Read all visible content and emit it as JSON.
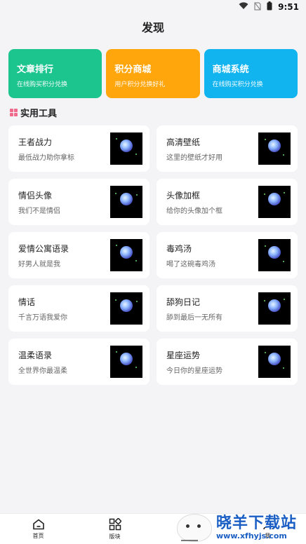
{
  "status_bar": {
    "time": "9:51"
  },
  "header": {
    "title": "发现"
  },
  "promos": [
    {
      "title": "文章排行",
      "subtitle": "在线购买积分兑换",
      "color": "#1dc58e"
    },
    {
      "title": "积分商城",
      "subtitle": "用户积分兑换好礼",
      "color": "#ffa60d"
    },
    {
      "title": "商城系统",
      "subtitle": "在线购买积分兑换",
      "color": "#12b4f0"
    }
  ],
  "section": {
    "title": "实用工具"
  },
  "tools": [
    {
      "name": "王者战力",
      "desc": "最低战力助你拿标"
    },
    {
      "name": "高清壁纸",
      "desc": "这里的壁纸才好用"
    },
    {
      "name": "情侣头像",
      "desc": "我们不是情侣"
    },
    {
      "name": "头像加框",
      "desc": "给你的头像加个框"
    },
    {
      "name": "爱情公寓语录",
      "desc": "好男人就是我"
    },
    {
      "name": "毒鸡汤",
      "desc": "喝了这碗毒鸡汤"
    },
    {
      "name": "情话",
      "desc": "千言万语我爱你"
    },
    {
      "name": "舔狗日记",
      "desc": "舔到最后一无所有"
    },
    {
      "name": "温柔语录",
      "desc": "全世界你最温柔"
    },
    {
      "name": "星座运势",
      "desc": "今日你的星座运势"
    }
  ],
  "bottom_nav": [
    {
      "label": "首页",
      "icon": "home-icon"
    },
    {
      "label": "版块",
      "icon": "grid-icon"
    },
    {
      "label": "",
      "icon": ""
    },
    {
      "label": "我",
      "icon": "user-icon"
    }
  ],
  "watermark": {
    "text": "晓羊下载站",
    "url": "www.xfhyjs.com"
  }
}
